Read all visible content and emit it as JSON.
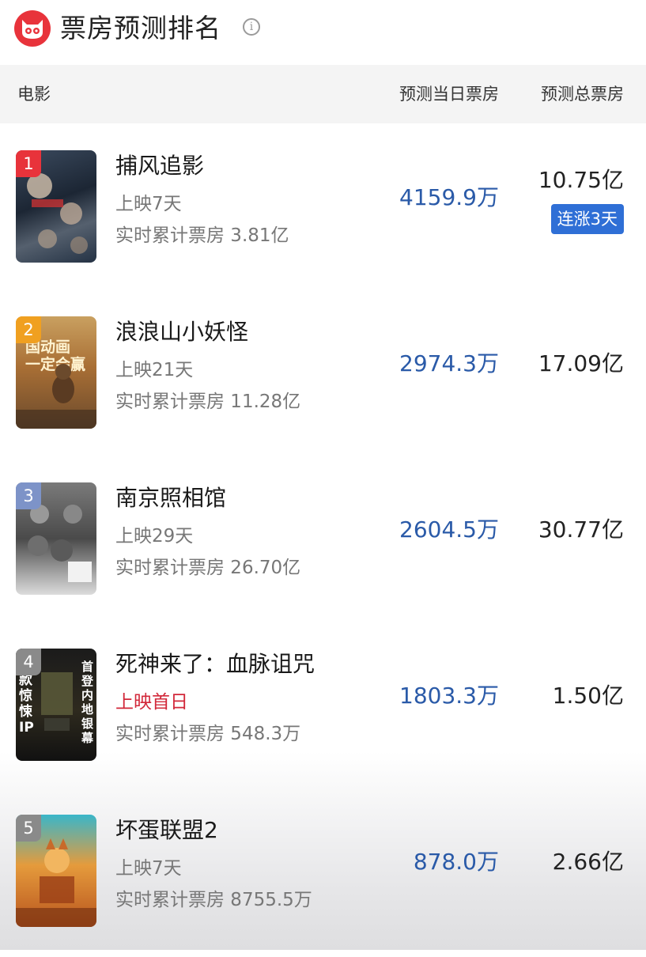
{
  "header": {
    "title": "票房预测排名",
    "logo_icon": "cat-eye-logo-icon",
    "info_icon": "info-icon",
    "info_glyph": "i"
  },
  "columns": {
    "movie": "电影",
    "today": "预测当日票房",
    "total": "预测总票房"
  },
  "colors": {
    "accent_red": "#e8333b",
    "today_blue": "#2a5aa8",
    "badge_blue": "#2f6fd6",
    "first_day_red": "#d2283a"
  },
  "movies": [
    {
      "rank": "1",
      "rank_color": "#e8333b",
      "title": "捕风追影",
      "days": "上映7天",
      "cumulative": "实时累计票房 3.81亿",
      "today": "4159.9万",
      "total": "10.75亿",
      "badge": "连涨3天"
    },
    {
      "rank": "2",
      "rank_color": "#f0a020",
      "title": "浪浪山小妖怪",
      "days": "上映21天",
      "cumulative": "实时累计票房 11.28亿",
      "today": "2974.3万",
      "total": "17.09亿",
      "poster_text": "国动画\n一定会赢"
    },
    {
      "rank": "3",
      "rank_color": "#7d93c8",
      "title": "南京照相馆",
      "days": "上映29天",
      "cumulative": "实时累计票房 26.70亿",
      "today": "2604.5万",
      "total": "30.77亿"
    },
    {
      "rank": "4",
      "rank_color": "#8a8a8a",
      "title": "死神来了：血脉诅咒",
      "days": "上映首日",
      "days_highlight": true,
      "cumulative": "实时累计票房 548.3万",
      "today": "1803.3万",
      "total": "1.50亿",
      "poster_text": "款\n惊\n悚\nIP",
      "poster_text_right": "首\n登\n内\n地\n银\n幕"
    },
    {
      "rank": "5",
      "rank_color": "#8a8a8a",
      "title": "坏蛋联盟2",
      "days": "上映7天",
      "cumulative": "实时累计票房 8755.5万",
      "today": "878.0万",
      "total": "2.66亿"
    }
  ]
}
